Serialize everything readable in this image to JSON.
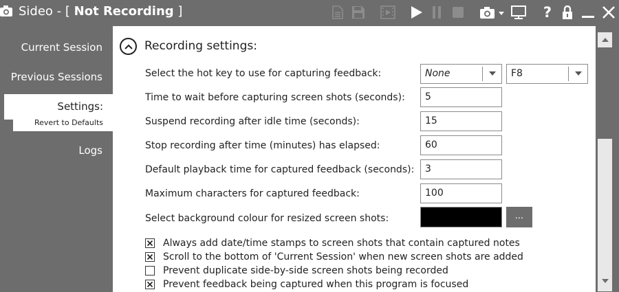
{
  "window": {
    "app_name": "Sideo - [",
    "status": "Not Recording",
    "close_bracket": "]"
  },
  "toolbar": {
    "icons": [
      "document-icon",
      "save-icon",
      "film-icon",
      "play-icon",
      "pause-icon",
      "stop-icon",
      "camera-icon",
      "monitor-icon",
      "help-icon",
      "lock-icon",
      "minimize-icon",
      "close-icon"
    ],
    "help_label": "?"
  },
  "sidebar": {
    "items": [
      {
        "label": "Current Session"
      },
      {
        "label": "Previous Sessions"
      },
      {
        "label": "Settings:",
        "sub_label": "Revert to Defaults"
      },
      {
        "label": "Logs"
      }
    ]
  },
  "settings": {
    "section_title": "Recording settings:",
    "hotkey": {
      "label": "Select the hot key to use for capturing feedback:",
      "modifier": "None",
      "key": "F8"
    },
    "rows": [
      {
        "label": "Time to wait before capturing screen shots (seconds):",
        "value": "5"
      },
      {
        "label": "Suspend recording after idle time (seconds):",
        "value": "15"
      },
      {
        "label": "Stop recording after time (minutes) has elapsed:",
        "value": "60"
      },
      {
        "label": "Default playback time for captured feedback (seconds):",
        "value": "3"
      },
      {
        "label": "Maximum characters for captured feedback:",
        "value": "100"
      }
    ],
    "background_colour": {
      "label": "Select background colour for resized screen shots:",
      "value": "#000000",
      "button_label": "..."
    },
    "checkboxes": [
      {
        "label": "Always add date/time stamps to screen shots that contain captured notes",
        "checked": true
      },
      {
        "label": "Scroll to the bottom of 'Current Session' when new screen shots are added",
        "checked": true
      },
      {
        "label": "Prevent duplicate side-by-side screen shots being recorded",
        "checked": false
      },
      {
        "label": "Prevent feedback being captured when this program is focused",
        "checked": true
      }
    ]
  },
  "colors": {
    "chrome": "#6d6d6d",
    "panel": "#ffffff",
    "text": "#222222",
    "disabled_icon": "#8c8c8c"
  }
}
